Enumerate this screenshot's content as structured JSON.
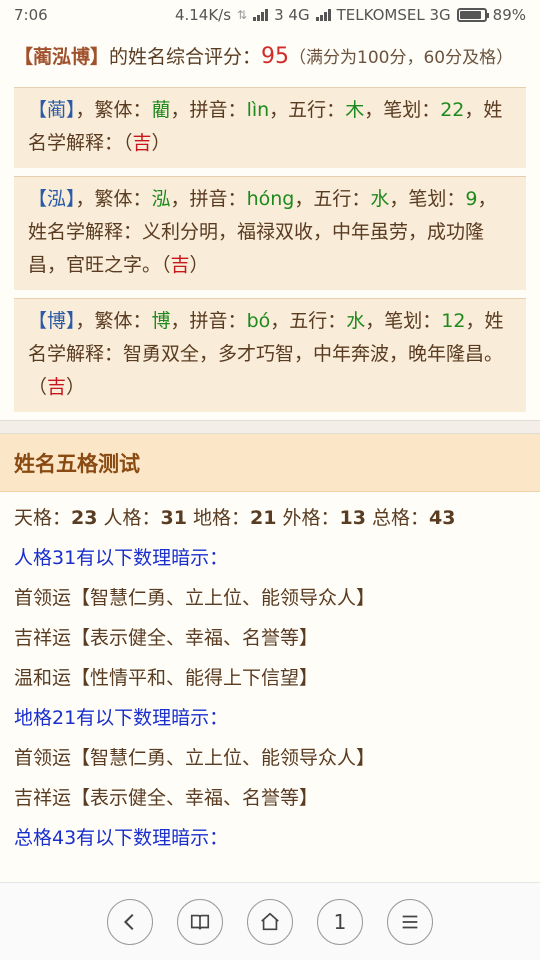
{
  "status": {
    "time": "7:06",
    "speed": "4.14K/s",
    "net1": "3 4G",
    "carrier": "TELKOMSEL 3G",
    "battery": "89%",
    "battery_level": 0.89
  },
  "summary": {
    "name": "【蔺泓博】",
    "text1": "的姓名综合评分：",
    "score": "95",
    "note": "（满分为100分，60分及格）"
  },
  "chars": [
    {
      "name": "【蔺】",
      "trad_label": "，繁体：",
      "trad": "藺",
      "pinyin_label": "，拼音：",
      "pinyin": "lìn",
      "wuxing_label": "，五行：",
      "wuxing": "木",
      "strokes_label": "，笔划：",
      "strokes": "22",
      "end": "，",
      "explain_label": "姓名学解释：",
      "explain": "（",
      "luck": "吉",
      "close": "）"
    },
    {
      "name": "【泓】",
      "trad_label": "，繁体：",
      "trad": "泓",
      "pinyin_label": "，拼音：",
      "pinyin": "hóng",
      "wuxing_label": "，五行：",
      "wuxing": "水",
      "strokes_label": "，笔划：",
      "strokes": "9",
      "end": "，",
      "explain_label": "姓名学解释：",
      "explain": "义利分明，福禄双收，中年虽劳，成功隆昌，官旺之字。（",
      "luck": "吉",
      "close": "）"
    },
    {
      "name": "【博】",
      "trad_label": "，繁体：",
      "trad": "博",
      "pinyin_label": "，拼音：",
      "pinyin": "bó",
      "wuxing_label": "，五行：",
      "wuxing": "水",
      "strokes_label": "，笔划：",
      "strokes": "12",
      "end": "，",
      "explain_label": "姓名学解释：",
      "explain": "智勇双全，多才巧智，中年奔波，晚年隆昌。（",
      "luck": "吉",
      "close": "）"
    }
  ],
  "wuge": {
    "title": "姓名五格测试",
    "tian_label": "天格：",
    "tian": "23",
    "ren_label": " 人格：",
    "ren": "31",
    "di_label": " 地格：",
    "di": "21",
    "wai_label": " 外格：",
    "wai": "13",
    "zong_label": " 总格：",
    "zong": "43",
    "lines": [
      {
        "kind": "blue",
        "text": "人格31有以下数理暗示："
      },
      {
        "kind": "plain",
        "text": "首领运【智慧仁勇、立上位、能领导众人】"
      },
      {
        "kind": "plain",
        "text": "吉祥运【表示健全、幸福、名誉等】"
      },
      {
        "kind": "plain",
        "text": "温和运【性情平和、能得上下信望】"
      },
      {
        "kind": "blue",
        "text": "地格21有以下数理暗示："
      },
      {
        "kind": "plain",
        "text": "首领运【智慧仁勇、立上位、能领导众人】"
      },
      {
        "kind": "plain",
        "text": "吉祥运【表示健全、幸福、名誉等】"
      },
      {
        "kind": "blue",
        "text": "总格43有以下数理暗示："
      }
    ]
  },
  "nav": {
    "back_icon": "chevron-left-icon",
    "book_icon": "book-icon",
    "home_icon": "home-icon",
    "tabs_count": "1",
    "menu_icon": "menu-icon"
  }
}
